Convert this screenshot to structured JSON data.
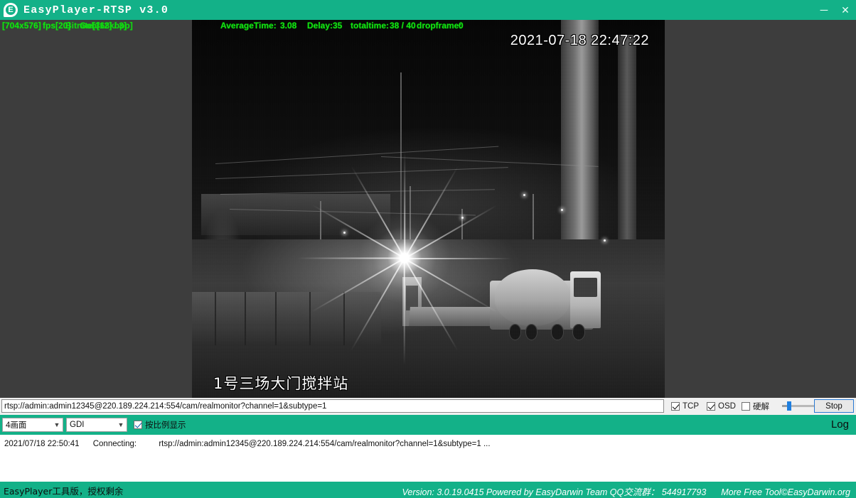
{
  "window": {
    "title": "EasyPlayer-RTSP v3.0",
    "icon": "easyplayer-logo-icon",
    "minimize_label": "─",
    "close_label": "✕",
    "accent_color": "#13b188"
  },
  "stats_overlay": {
    "resolution": "[704x576]",
    "fps_text": "fps[20]",
    "bitrate_text": "Bitrate[368kbpp]",
    "gop_text": "Gob[12] / 3]",
    "average_time_label": "AverageTime:",
    "average_time": "3.08",
    "delay_label": "Delay:",
    "delay": "35",
    "totaltime_label": "totaltime:",
    "totaltime": "38 / 40",
    "dropframe_label": "dropframe:",
    "dropframe": "0",
    "full_line": "[704x576] fps[20] Bitrate[368kbpp] Gobb[12] / 3]  AverageTime: 3.08  Delay: 35  totaltime:38 / 40 dropframe:0",
    "color": "#13e013"
  },
  "video": {
    "osd_timestamp": "2021-07-18 22:47:22",
    "osd_channel_name": "1号三场大门搅拌站"
  },
  "controls": {
    "url_value": "rtsp://admin:admin12345@220.189.224.214:554/cam/realmonitor?channel=1&subtype=1",
    "url_placeholder": "rtsp://",
    "tcp_label": "TCP",
    "tcp_checked": true,
    "osd_label": "OSD",
    "osd_checked": true,
    "hard_decode_label": "硬解",
    "hard_decode_checked": false,
    "volume_value": 15,
    "stop_label": "Stop"
  },
  "toolbar": {
    "layout_value": "4画面",
    "render_value": "GDI",
    "scale_label": "按比例显示",
    "scale_checked": true,
    "log_label": "Log"
  },
  "log": {
    "entries": [
      {
        "time": "2021/07/18 22:50:41",
        "action": "Connecting:",
        "detail": "rtsp://admin:admin12345@220.189.224.214:554/cam/realmonitor?channel=1&subtype=1 ..."
      }
    ]
  },
  "statusbar": {
    "left_text": "EasyPlayer工具版，授权剩余",
    "version_text": "Version: 3.0.19.0415 Powered by EasyDarwin Team QQ交流群： 544917793",
    "more_text": "More Free Tool©EasyDarwin.org"
  }
}
